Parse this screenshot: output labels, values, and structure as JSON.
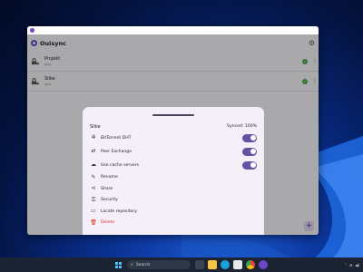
{
  "app": {
    "name": "Ouisync"
  },
  "repos": [
    {
      "name": "Projekt",
      "sub": "sync"
    },
    {
      "name": "Slike",
      "sub": "sync"
    }
  ],
  "sheet": {
    "title": "Slike",
    "status": "Synced: 100%",
    "toggles": [
      {
        "label": "BitTorrent DHT",
        "icon": "dht-icon",
        "on": true
      },
      {
        "label": "Peer Exchange",
        "icon": "peer-exchange-icon",
        "on": true
      },
      {
        "label": "Use cache servers",
        "icon": "cloud-icon",
        "on": true
      }
    ],
    "actions": [
      {
        "label": "Rename",
        "icon": "edit-icon"
      },
      {
        "label": "Share",
        "icon": "share-icon"
      },
      {
        "label": "Security",
        "icon": "key-icon"
      },
      {
        "label": "Locate repository",
        "icon": "folder-icon"
      },
      {
        "label": "Delete",
        "icon": "trash-icon"
      }
    ]
  },
  "taskbar": {
    "search_placeholder": "Search"
  },
  "colors": {
    "accent": "#6750a4",
    "danger": "#d93025",
    "success": "#4caf50"
  }
}
